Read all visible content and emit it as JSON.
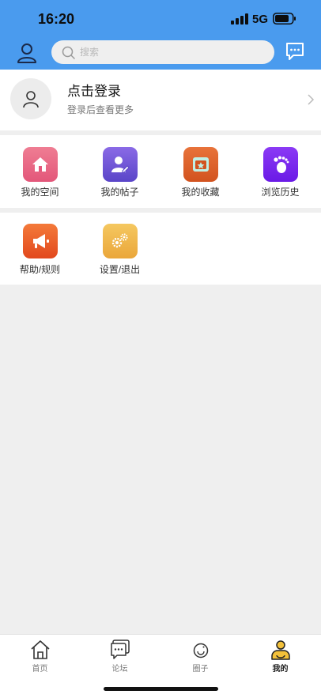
{
  "status": {
    "time": "16:20",
    "network": "5G"
  },
  "header": {
    "search_placeholder": "搜索"
  },
  "login": {
    "title": "点击登录",
    "subtitle": "登录后查看更多"
  },
  "menu_row1": [
    {
      "label": "我的空间",
      "icon": "home-icon",
      "color": "#e3577a"
    },
    {
      "label": "我的帖子",
      "icon": "user-edit-icon",
      "color": "#6a4fd3"
    },
    {
      "label": "我的收藏",
      "icon": "folder-star-icon",
      "color": "#dd5a2a"
    },
    {
      "label": "浏览历史",
      "icon": "footprint-icon",
      "color": "#7a23f0"
    }
  ],
  "menu_row2": [
    {
      "label": "帮助/规则",
      "icon": "megaphone-icon",
      "color": "#f05a2c"
    },
    {
      "label": "设置/退出",
      "icon": "gears-icon",
      "color": "#f0b548"
    }
  ],
  "tabs": [
    {
      "label": "首页",
      "icon": "home-icon",
      "active": false
    },
    {
      "label": "论坛",
      "icon": "chat-icon",
      "active": false
    },
    {
      "label": "圈子",
      "icon": "circle-icon",
      "active": false
    },
    {
      "label": "我的",
      "icon": "profile-icon",
      "active": true
    }
  ],
  "colors": {
    "header": "#4a9bee",
    "active_tab": "#f3c13a"
  }
}
